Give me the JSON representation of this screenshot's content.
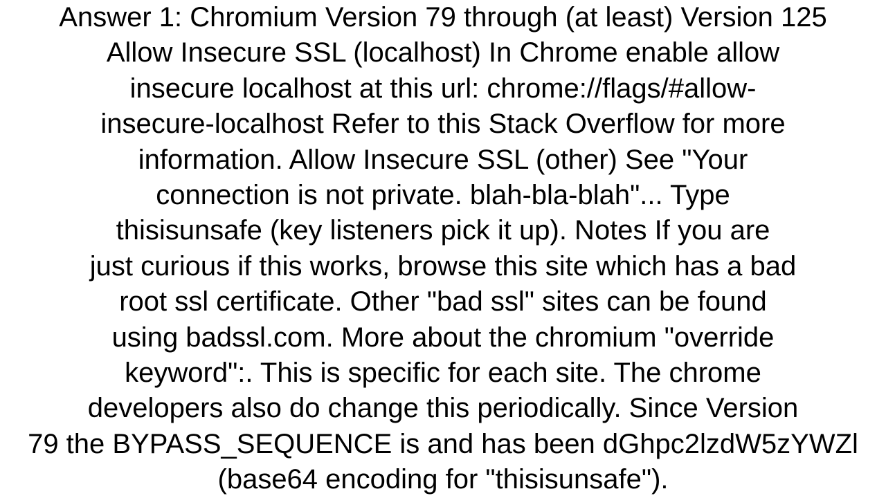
{
  "page": {
    "background_color": "#ffffff",
    "text_color": "#000000",
    "title": "Answer 1: Chromium Version 79 through (at least) Version 125"
  },
  "answer": {
    "label": "Answer 1",
    "full_text": "Answer 1: Chromium Version 79 through (at least) Version 125 Allow Insecure SSL (localhost) In Chrome enable allow insecure localhost at this url:  chrome://flags/#allow-insecure-localhost   Refer to this Stack Overflow for more information.  Allow Insecure SSL (other)  See \"Your connection is not private. blah-bla-blah\"... Type thisisunsafe (key listeners pick it up).   Notes If you are just curious if this works, browse this site which has a bad root ssl certificate. Other \"bad ssl\" sites can be found using badssl.com. More about the chromium \"override keyword\":.  This is specific for each site.  The chrome developers also do change this periodically.  Since Version 79 the BYPASS_SEQUENCE is and has been dGhpc2lzdW5zYWZl (base64 encoding for \"thisisunsafe\").",
    "lines": [
      "Answer 1: Chromium Version 79 through (at least) Version 125",
      "Allow Insecure SSL (localhost) In Chrome enable allow",
      "insecure localhost at this url:  chrome://flags/#allow-",
      "insecure-localhost   Refer to this Stack Overflow for more",
      "information.  Allow Insecure SSL (other)  See \"Your",
      "connection is not private. blah-bla-blah\"... Type",
      "thisisunsafe (key listeners pick it up).   Notes If you are",
      "just curious if this works, browse this site which has a bad",
      "root ssl certificate. Other \"bad ssl\" sites can be found",
      "using badssl.com. More about the chromium \"override",
      "keyword\":.  This is specific for each site.  The chrome",
      "developers also do change this periodically.  Since Version",
      "79 the BYPASS_SEQUENCE is and has been dGhpc2lzdW5zYWZl",
      "(base64 encoding for \"thisisunsafe\")."
    ],
    "mentions": {
      "chrome_flag_url": "chrome://flags/#allow-insecure-localhost",
      "bypass_sequence_name": "BYPASS_SEQUENCE",
      "bypass_sequence_value": "dGhpc2lzdW5zYWZl",
      "bypass_keyword": "thisisunsafe",
      "bad_ssl_site": "badssl.com",
      "version_start": "79",
      "version_end": "125"
    }
  }
}
